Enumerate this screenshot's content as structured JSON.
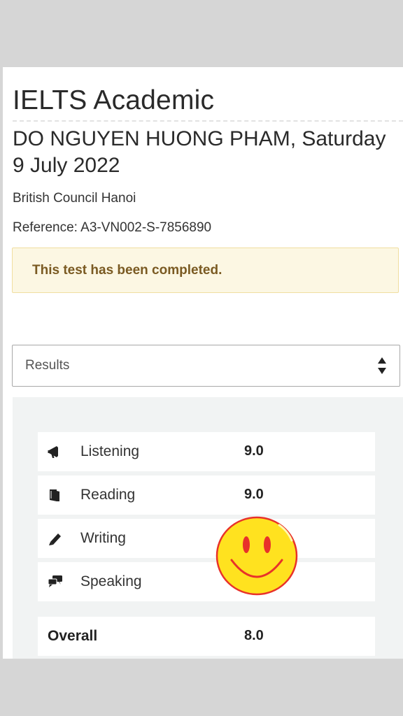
{
  "test": {
    "title": "IELTS Academic",
    "candidate_line": "DO NGUYEN HUONG PHAM, Saturday 9 July 2022",
    "centre": "British Council Hanoi",
    "reference": "Reference: A3-VN002-S-7856890"
  },
  "alert": {
    "message": "This test has been completed."
  },
  "view_select": {
    "selected": "Results"
  },
  "results": {
    "modules": [
      {
        "label": "Listening",
        "score": "9.0",
        "icon": "megaphone-icon"
      },
      {
        "label": "Reading",
        "score": "9.0",
        "icon": "book-icon"
      },
      {
        "label": "Writing",
        "score": "",
        "icon": "pencil-icon"
      },
      {
        "label": "Speaking",
        "score": "",
        "icon": "speech-bubbles-icon"
      }
    ],
    "overall": {
      "label": "Overall",
      "score": "8.0"
    }
  },
  "colors": {
    "alert_bg": "#fcf7e3",
    "alert_text": "#7a5a22",
    "panel_bg": "#f1f3f3",
    "smiley_fill": "#ffe21f",
    "smiley_outline": "#e8322a"
  },
  "sticker": {
    "icon": "smiley-face-icon"
  }
}
